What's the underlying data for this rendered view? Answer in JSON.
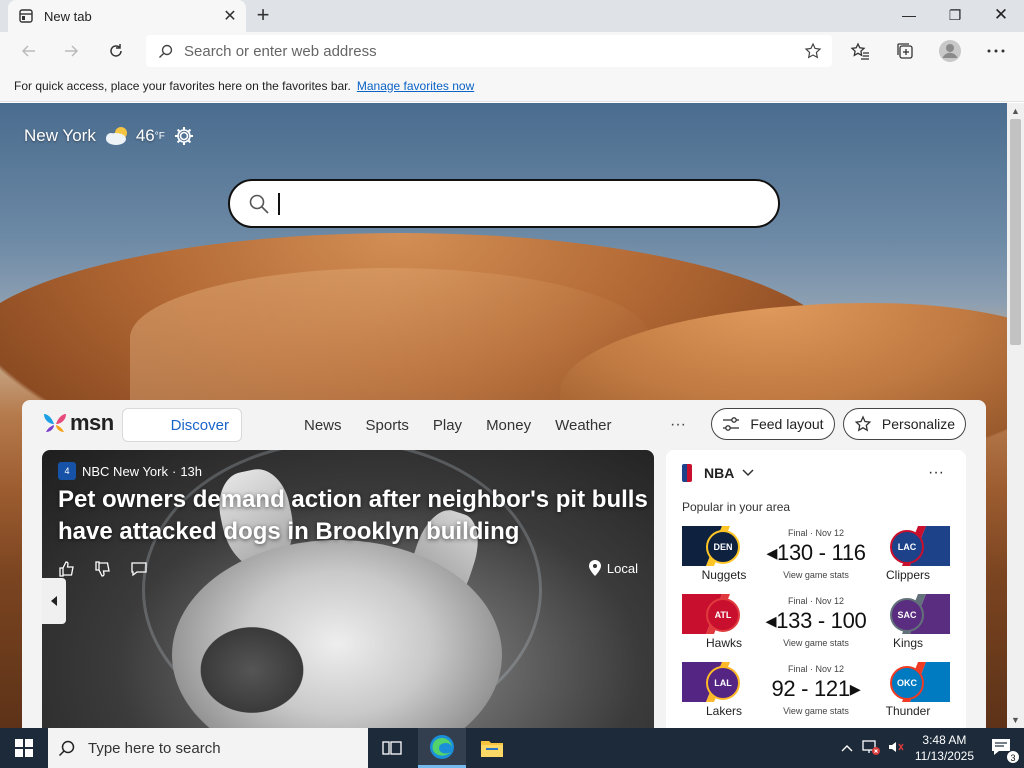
{
  "tab": {
    "title": "New tab",
    "close": "✕",
    "new_tab": "+"
  },
  "window": {
    "minimize": "—",
    "restore": "❐",
    "close": "✕"
  },
  "address": {
    "placeholder": "Search or enter web address"
  },
  "favorites_bar": {
    "message": "For quick access, place your favorites here on the favorites bar.",
    "link": "Manage favorites now"
  },
  "weather": {
    "location": "New York",
    "temperature": "46",
    "unit": "°F"
  },
  "msn": {
    "logo": "msn",
    "tabs": [
      "Discover",
      "News",
      "Sports",
      "Play",
      "Money",
      "Weather"
    ],
    "more": "···",
    "feed_layout": "Feed layout",
    "personalize": "Personalize"
  },
  "hero": {
    "source": "NBC New York",
    "source_logo": "4",
    "age": "13h",
    "separator": "·",
    "title": "Pet owners demand action after neighbor's pit bulls have attacked dogs in Brooklyn building",
    "tag": "Local"
  },
  "nba": {
    "title": "NBA",
    "subtitle": "Popular in your area",
    "more": "···",
    "games": [
      {
        "status": "Final · Nov 12",
        "score": "130 - 116",
        "winner": "left",
        "stats": "View game stats",
        "left": {
          "name": "Nuggets",
          "abbr": "DEN",
          "color": "#0e2240",
          "accent": "#fec524"
        },
        "right": {
          "name": "Clippers",
          "abbr": "LAC",
          "color": "#1d428a",
          "accent": "#c8102e"
        }
      },
      {
        "status": "Final · Nov 12",
        "score": "133 - 100",
        "winner": "left",
        "stats": "View game stats",
        "left": {
          "name": "Hawks",
          "abbr": "ATL",
          "color": "#c8102e",
          "accent": "#e03a3e"
        },
        "right": {
          "name": "Kings",
          "abbr": "SAC",
          "color": "#5a2d81",
          "accent": "#63727a"
        }
      },
      {
        "status": "Final · Nov 12",
        "score": "92 - 121",
        "winner": "right",
        "stats": "View game stats",
        "left": {
          "name": "Lakers",
          "abbr": "LAL",
          "color": "#552583",
          "accent": "#fdb927"
        },
        "right": {
          "name": "Thunder",
          "abbr": "OKC",
          "color": "#007ac1",
          "accent": "#ef3b24"
        }
      }
    ]
  },
  "taskbar": {
    "search_placeholder": "Type here to search",
    "time": "3:48 AM",
    "date": "11/13/2025",
    "notifications": "3"
  },
  "colors": {
    "accent": "#1a64c8",
    "taskbar": "#1c2a3a",
    "link": "#0b63c5"
  }
}
